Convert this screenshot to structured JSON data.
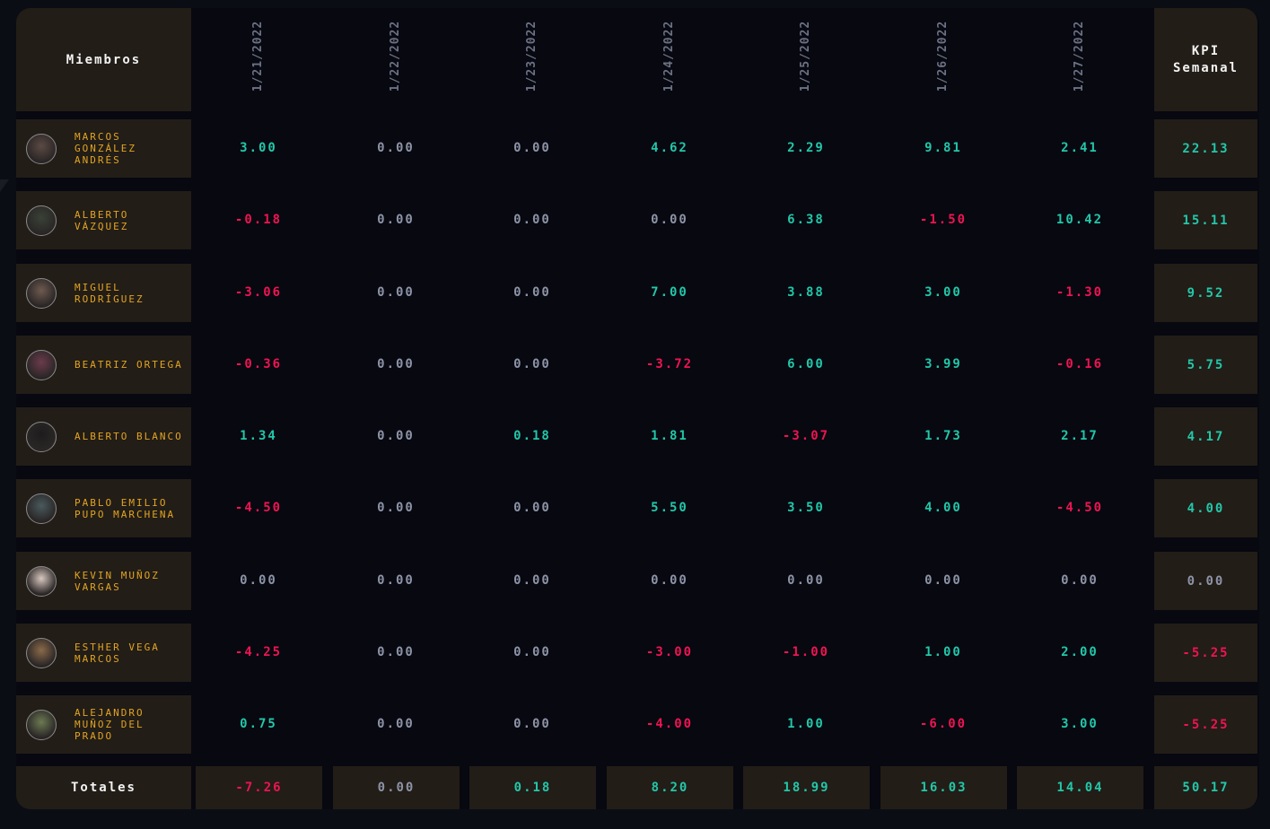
{
  "header": {
    "members_label": "Miembros",
    "kpi_label_line1": "KPI",
    "kpi_label_line2": "Semanal",
    "dates": [
      "1/21/2022",
      "1/22/2022",
      "1/23/2022",
      "1/24/2022",
      "1/25/2022",
      "1/26/2022",
      "1/27/2022"
    ]
  },
  "members": [
    {
      "name": "MARCOS GONZÁLEZ ANDRÉS",
      "values": [
        "3.00",
        "0.00",
        "0.00",
        "4.62",
        "2.29",
        "9.81",
        "2.41"
      ],
      "kpi": "22.13",
      "avatar_color": "#5c4a44"
    },
    {
      "name": "ALBERTO VÁZQUEZ",
      "values": [
        "-0.18",
        "0.00",
        "0.00",
        "0.00",
        "6.38",
        "-1.50",
        "10.42"
      ],
      "kpi": "15.11",
      "avatar_color": "#394236"
    },
    {
      "name": "MIGUEL RODRÍGUEZ",
      "values": [
        "-3.06",
        "0.00",
        "0.00",
        "7.00",
        "3.88",
        "3.00",
        "-1.30"
      ],
      "kpi": "9.52",
      "avatar_color": "#6e5a50"
    },
    {
      "name": "BEATRIZ ORTEGA",
      "values": [
        "-0.36",
        "0.00",
        "0.00",
        "-3.72",
        "6.00",
        "3.99",
        "-0.16"
      ],
      "kpi": "5.75",
      "avatar_color": "#6b3b4c"
    },
    {
      "name": "ALBERTO BLANCO",
      "values": [
        "1.34",
        "0.00",
        "0.18",
        "1.81",
        "-3.07",
        "1.73",
        "2.17"
      ],
      "kpi": "4.17",
      "avatar_color": "#1d1c1c"
    },
    {
      "name": "PABLO EMILIO PUPO MARCHENA",
      "values": [
        "-4.50",
        "0.00",
        "0.00",
        "5.50",
        "3.50",
        "4.00",
        "-4.50"
      ],
      "kpi": "4.00",
      "avatar_color": "#4a5a5e"
    },
    {
      "name": "KEVIN MUÑOZ VARGAS",
      "values": [
        "0.00",
        "0.00",
        "0.00",
        "0.00",
        "0.00",
        "0.00",
        "0.00"
      ],
      "kpi": "0.00",
      "avatar_color": "#d9c8c0"
    },
    {
      "name": "ESTHER VEGA MARCOS",
      "values": [
        "-4.25",
        "0.00",
        "0.00",
        "-3.00",
        "-1.00",
        "1.00",
        "2.00"
      ],
      "kpi": "-5.25",
      "avatar_color": "#8a6a4a"
    },
    {
      "name": "ALEJANDRO MUÑOZ DEL PRADO",
      "values": [
        "0.75",
        "0.00",
        "0.00",
        "-4.00",
        "1.00",
        "-6.00",
        "3.00"
      ],
      "kpi": "-5.25",
      "avatar_color": "#6c7a52"
    }
  ],
  "totals": {
    "label": "Totales",
    "values": [
      "-7.26",
      "0.00",
      "0.18",
      "8.20",
      "18.99",
      "16.03",
      "14.04"
    ],
    "kpi": "50.17"
  },
  "colors": {
    "positive": "#22c7a9",
    "negative": "#ee1452",
    "zero": "#8d93a6",
    "member_name": "#e3a422",
    "cell_bg": "#221d17"
  }
}
